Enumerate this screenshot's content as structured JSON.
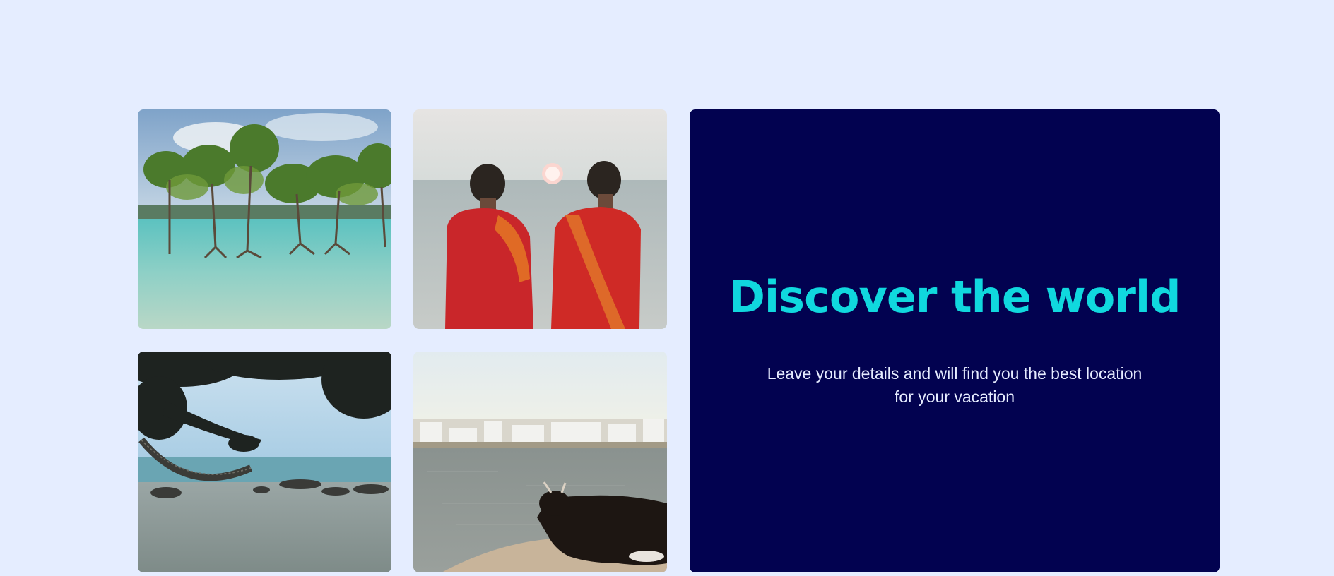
{
  "gallery": {
    "images": [
      {
        "name": "mangrove-trees-in-shallow-sea"
      },
      {
        "name": "two-women-in-red-saris-at-sunset"
      },
      {
        "name": "hammock-on-tropical-beach"
      },
      {
        "name": "cow-resting-by-lake-town"
      }
    ]
  },
  "hero": {
    "title": "Discover the world",
    "description": "Leave your details and will find you the best location for your vacation"
  },
  "colors": {
    "page_background": "#e5edff",
    "panel_background": "#020250",
    "title_accent": "#10d8de",
    "body_text": "#e6ecff"
  }
}
